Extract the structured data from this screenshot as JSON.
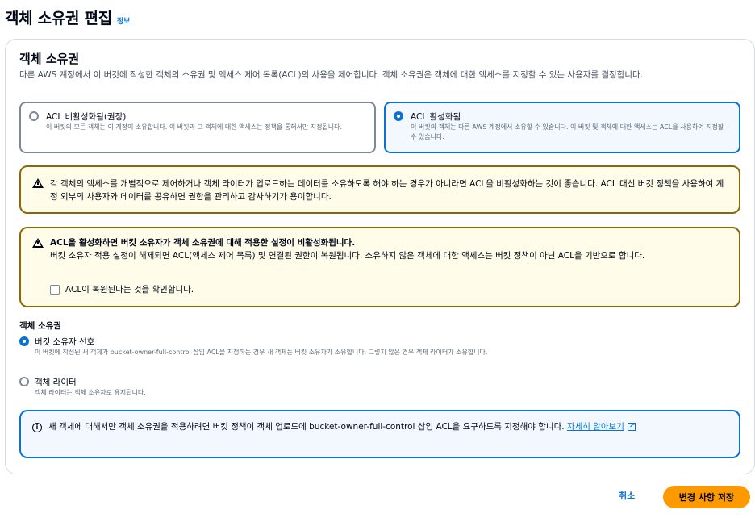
{
  "header": {
    "title": "객체 소유권 편집",
    "info_link": "정보"
  },
  "section": {
    "title": "객체 소유권",
    "description": "다른 AWS 계정에서 이 버킷에 작성한 객체의 소유권 및 액세스 제어 목록(ACL)의 사용을 제어합니다. 객체 소유권은 객체에 대한 액세스를 지정할 수 있는 사용자를 결정합니다."
  },
  "acl_tiles": [
    {
      "label": "ACL 비활성화됨(권장)",
      "description": "이 버킷의 모든 객체는 이 계정이 소유합니다. 이 버킷과 그 객체에 대한 액세스는 정책을 통해서만 지정됩니다.",
      "selected": false
    },
    {
      "label": "ACL 활성화됨",
      "description": "이 버킷의 객체는 다른 AWS 계정에서 소유할 수 있습니다. 이 버킷 및 객체에 대한 액세스는 ACL을 사용하여 지정할 수 있습니다.",
      "selected": true
    }
  ],
  "warning1": {
    "text": "각 객체의 액세스를 개별적으로 제어하거나 객체 라이터가 업로드하는 데이터를 소유하도록 해야 하는 경우가 아니라면 ACL을 비활성화하는 것이 좋습니다. ACL 대신 버킷 정책을 사용하여 계정 외부의 사용자와 데이터를 공유하면 권한을 관리하고 감사하기가 용이합니다."
  },
  "warning2": {
    "title": "ACL을 활성화하면 버킷 소유자가 객체 소유권에 대해 적용한 설정이 비활성화됩니다.",
    "text": "버킷 소유자 적용 설정이 해제되면 ACL(액세스 제어 목록) 및 연결된 권한이 복원됩니다. 소유하지 않은 객체에 대한 액세스는 버킷 정책이 아닌 ACL을 기반으로 합니다.",
    "checkbox_label": "ACL이 복원된다는 것을 확인합니다.",
    "checked": false
  },
  "ownership": {
    "label": "객체 소유권",
    "options": [
      {
        "label": "버킷 소유자 선호",
        "description": "이 버킷에 작성된 새 객체가 bucket-owner-full-control 삽입 ACL을 지정하는 경우 새 객체는 버킷 소유자가 소유합니다. 그렇지 않은 경우 객체 라이터가 소유합니다.",
        "selected": true
      },
      {
        "label": "객체 라이터",
        "description": "객체 라이터는 객체 소유자로 유지됩니다.",
        "selected": false
      }
    ]
  },
  "info_alert": {
    "text": "새 객체에 대해서만 객체 소유권을 적용하려면 버킷 정책이 객체 업로드에 bucket-owner-full-control 삽입 ACL을 요구하도록 지정해야 합니다. ",
    "link": "자세히 알아보기"
  },
  "footer": {
    "cancel_label": "취소",
    "save_label": "변경 사항 저장"
  },
  "colors": {
    "accent": "#0972d3",
    "primary_button": "#ff9900",
    "warning_border": "#8d6605"
  }
}
